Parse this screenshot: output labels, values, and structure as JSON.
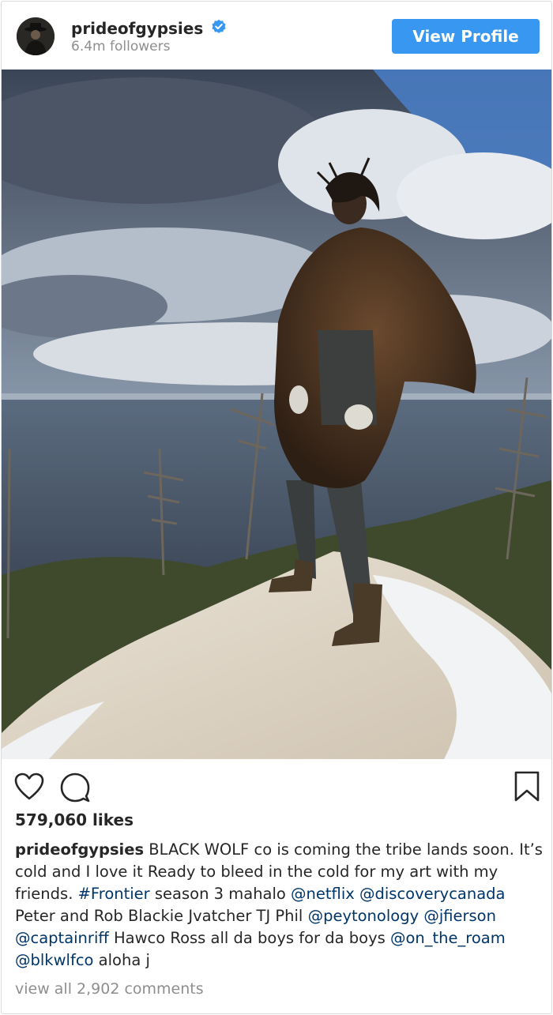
{
  "header": {
    "username": "prideofgypsies",
    "followers": "6.4m followers",
    "view_profile_label": "View Profile"
  },
  "post": {
    "image_alt": "Man in a fur cloak standing on a snowy rock above the sea",
    "likes": "579,060 likes",
    "caption": {
      "username": "prideofgypsies",
      "seg1": " BLACK WOLF co is coming the tribe lands soon. It’s cold and I love it Ready to bleed in the cold for my art with my friends. ",
      "tag_frontier": "#Frontier",
      "seg2": " season 3 mahalo ",
      "mention_netflix": "@netflix",
      "seg3": " ",
      "mention_discovery": "@discoverycanada",
      "seg4": " Peter and Rob Blackie Jvatcher TJ Phil ",
      "mention_peyton": "@peytonology",
      "seg5": " ",
      "mention_jfierson": "@jfierson",
      "seg6": " ",
      "mention_captainriff": "@captainriff",
      "seg7": " Hawco Ross all da boys for da boys ",
      "mention_ontheroam": "@on_the_roam",
      "seg8": " ",
      "mention_blkwlfco": "@blkwlfco",
      "seg9": " aloha j"
    },
    "view_comments": "view all 2,902 comments"
  },
  "icons": [
    "verified-badge-icon",
    "heart-icon",
    "comment-icon",
    "bookmark-icon"
  ],
  "colors": {
    "accent": "#3897f0",
    "link": "#003569",
    "muted": "#8e8e8e",
    "text": "#262626"
  }
}
